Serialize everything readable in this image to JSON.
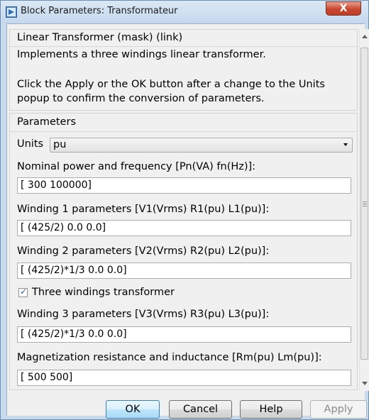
{
  "window": {
    "title": "Block Parameters: Transformateur",
    "close_label": "X"
  },
  "description": {
    "header": "Linear Transformer (mask) (link)",
    "line1": "Implements a three windings linear transformer.",
    "line2": "Click the Apply or the OK button after a change to the Units",
    "line3": "popup to confirm the conversion of parameters."
  },
  "parameters": {
    "header": "Parameters",
    "units_label": "Units",
    "units_value": "pu",
    "nominal_label": "Nominal power and frequency [Pn(VA) fn(Hz)]:",
    "nominal_value": "[ 300 100000]",
    "w1_label": "Winding 1 parameters [V1(Vrms) R1(pu) L1(pu)]:",
    "w1_value": "[ (425/2)  0.0  0.0]",
    "w2_label": "Winding 2 parameters [V2(Vrms) R2(pu) L2(pu)]:",
    "w2_value": "[ (425/2)*1/3  0.0  0.0]",
    "three_windings_label": "Three windings transformer",
    "three_windings_checked": true,
    "w3_label": "Winding 3 parameters [V3(Vrms) R3(pu) L3(pu)]:",
    "w3_value": "[ (425/2)*1/3  0.0 0.0]",
    "mag_label": "Magnetization resistance and inductance [Rm(pu) Lm(pu)]:",
    "mag_value": "[ 500 500]"
  },
  "buttons": {
    "ok": "OK",
    "cancel": "Cancel",
    "help": "Help",
    "apply": "Apply"
  },
  "icons": {
    "app": "block-parameters-icon",
    "close": "close-icon",
    "check": "checkmark-icon"
  }
}
